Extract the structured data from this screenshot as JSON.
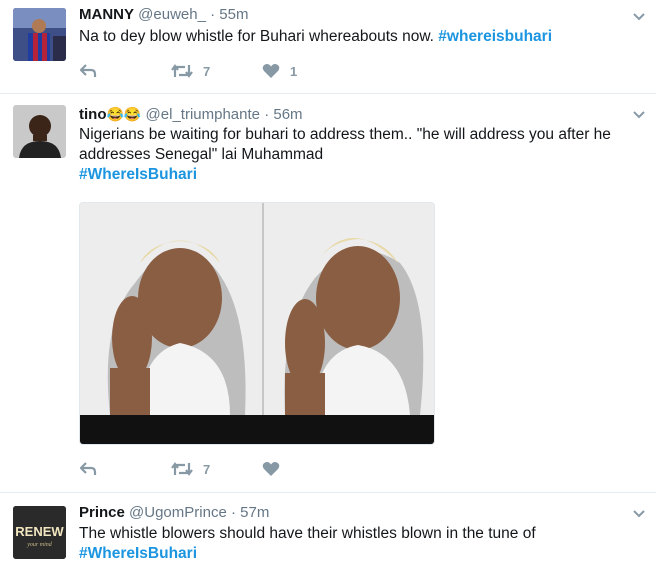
{
  "tweets": [
    {
      "name": "MANNY",
      "handle": "@euweh_",
      "sep": "·",
      "time": "55m",
      "text_plain": "Na to dey blow whistle for Buhari whereabouts now.",
      "hashtag": "#whereisbuhari",
      "retweets": "7",
      "likes": "1",
      "avatar_icon": "football-player-avatar"
    },
    {
      "name": "tino",
      "emoji": "😂😂",
      "handle": "@el_triumphante",
      "sep": "·",
      "time": "56m",
      "line1": "Nigerians be waiting for buhari to address them.. \"he will address you after he",
      "line2": "addresses Senegal\" lai Muhammad",
      "hashtag": "#WhereIsBuhari",
      "retweets": "7",
      "likes": "",
      "media_icon": "two-panel-thinking-man-meme"
    },
    {
      "name": "Prince",
      "handle": "@UgomPrince",
      "sep": "·",
      "time": "57m",
      "text_plain": "The whistle blowers should have their whistles blown in the tune of",
      "hashtag": "#WhereIsBuhari",
      "avatar_text_1": "RENEW",
      "avatar_text_2": "your mind"
    }
  ],
  "colors": {
    "hashtag": "#1b95e0",
    "muted": "#657786",
    "icon": "#8899a6",
    "divider": "#e6ecf0"
  }
}
